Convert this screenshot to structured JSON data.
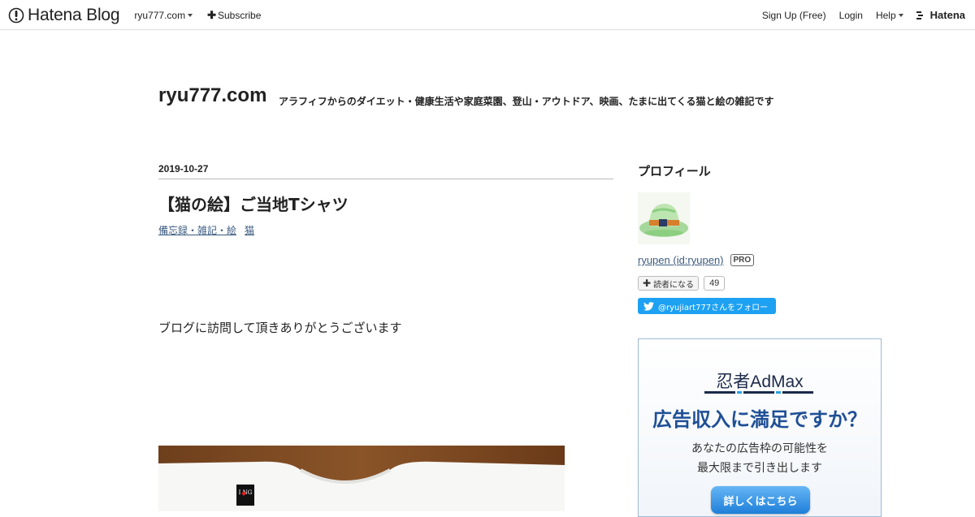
{
  "globalheader": {
    "logo_text": "Hatena Blog",
    "blog_menu_label": "ryu777.com",
    "subscribe_label": "Subscribe",
    "signup_label": "Sign Up (Free)",
    "login_label": "Login",
    "help_label": "Help",
    "hatena_label": "Hatena"
  },
  "blog": {
    "title": "ryu777.com",
    "description": "アラフィフからのダイエット・健康生活や家庭菜園、登山・アウトドア、映画、たまに出てくる猫と絵の雑記です"
  },
  "entry": {
    "date": "2019-10-27",
    "title": "【猫の絵】ご当地Tシャツ",
    "categories": [
      "備忘録・雑記・絵",
      "猫"
    ],
    "body_text": "ブログに訪問して頂きありがとうございます",
    "tshirt_tag_text": "I NG"
  },
  "sidebar": {
    "profile_heading": "プロフィール",
    "profile_name": "ryupen (id:ryupen)",
    "pro_badge": "PRO",
    "subscribe_button": "読者になる",
    "subscriber_count": "49",
    "twitter_follow": "@ryujiart777さんをフォロー"
  },
  "ad": {
    "logo": "忍者AdMax",
    "headline": "広告収入に満足ですか？",
    "subline1": "あなたの広告枠の可能性を",
    "subline2": "最大限まで引き出します",
    "cta": "詳しくはこちら"
  },
  "colors": {
    "link": "#3b5b80",
    "twitter": "#1da1f2",
    "ad_headline": "#1f4f96"
  }
}
